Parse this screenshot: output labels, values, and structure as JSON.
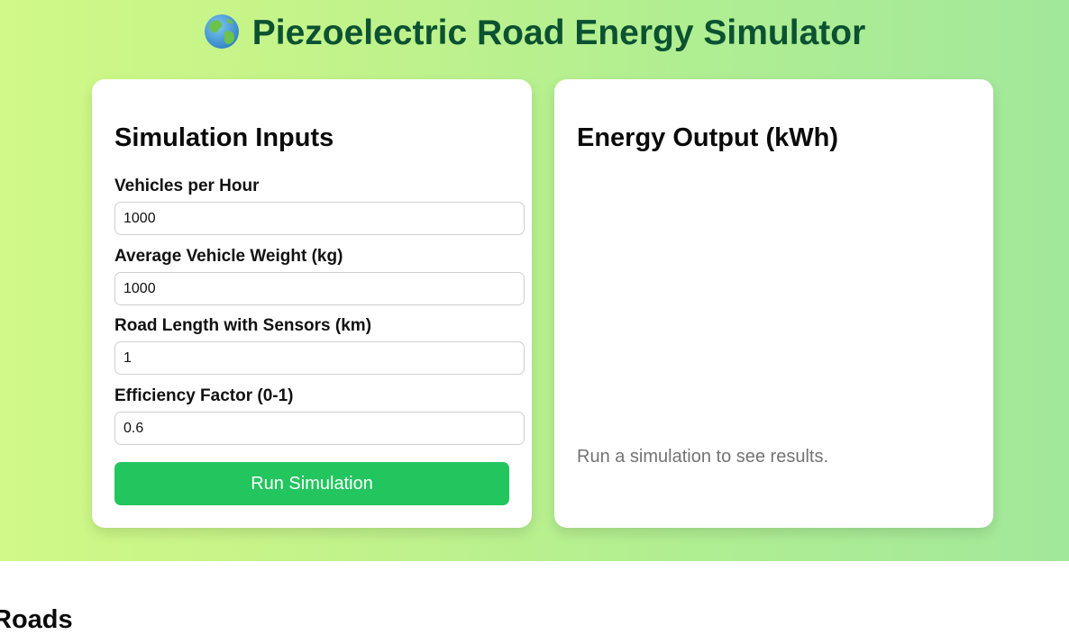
{
  "header": {
    "icon": "globe-icon",
    "title": "Piezoelectric Road Energy Simulator",
    "title_color": "#0b5232"
  },
  "inputs_panel": {
    "heading": "Simulation Inputs",
    "fields": [
      {
        "label": "Vehicles per Hour",
        "value": "1000"
      },
      {
        "label": "Average Vehicle Weight (kg)",
        "value": "1000"
      },
      {
        "label": "Road Length with Sensors (km)",
        "value": "1"
      },
      {
        "label": "Efficiency Factor (0-1)",
        "value": "0.6"
      }
    ],
    "run_button_label": "Run Simulation",
    "run_button_color": "#22c55e"
  },
  "output_panel": {
    "heading": "Energy Output (kWh)",
    "empty_message": "Run a simulation to see results."
  },
  "next_section": {
    "heading": "Roads"
  },
  "colors": {
    "gradient_start": "#d0f987",
    "gradient_end": "#a2e89b"
  }
}
